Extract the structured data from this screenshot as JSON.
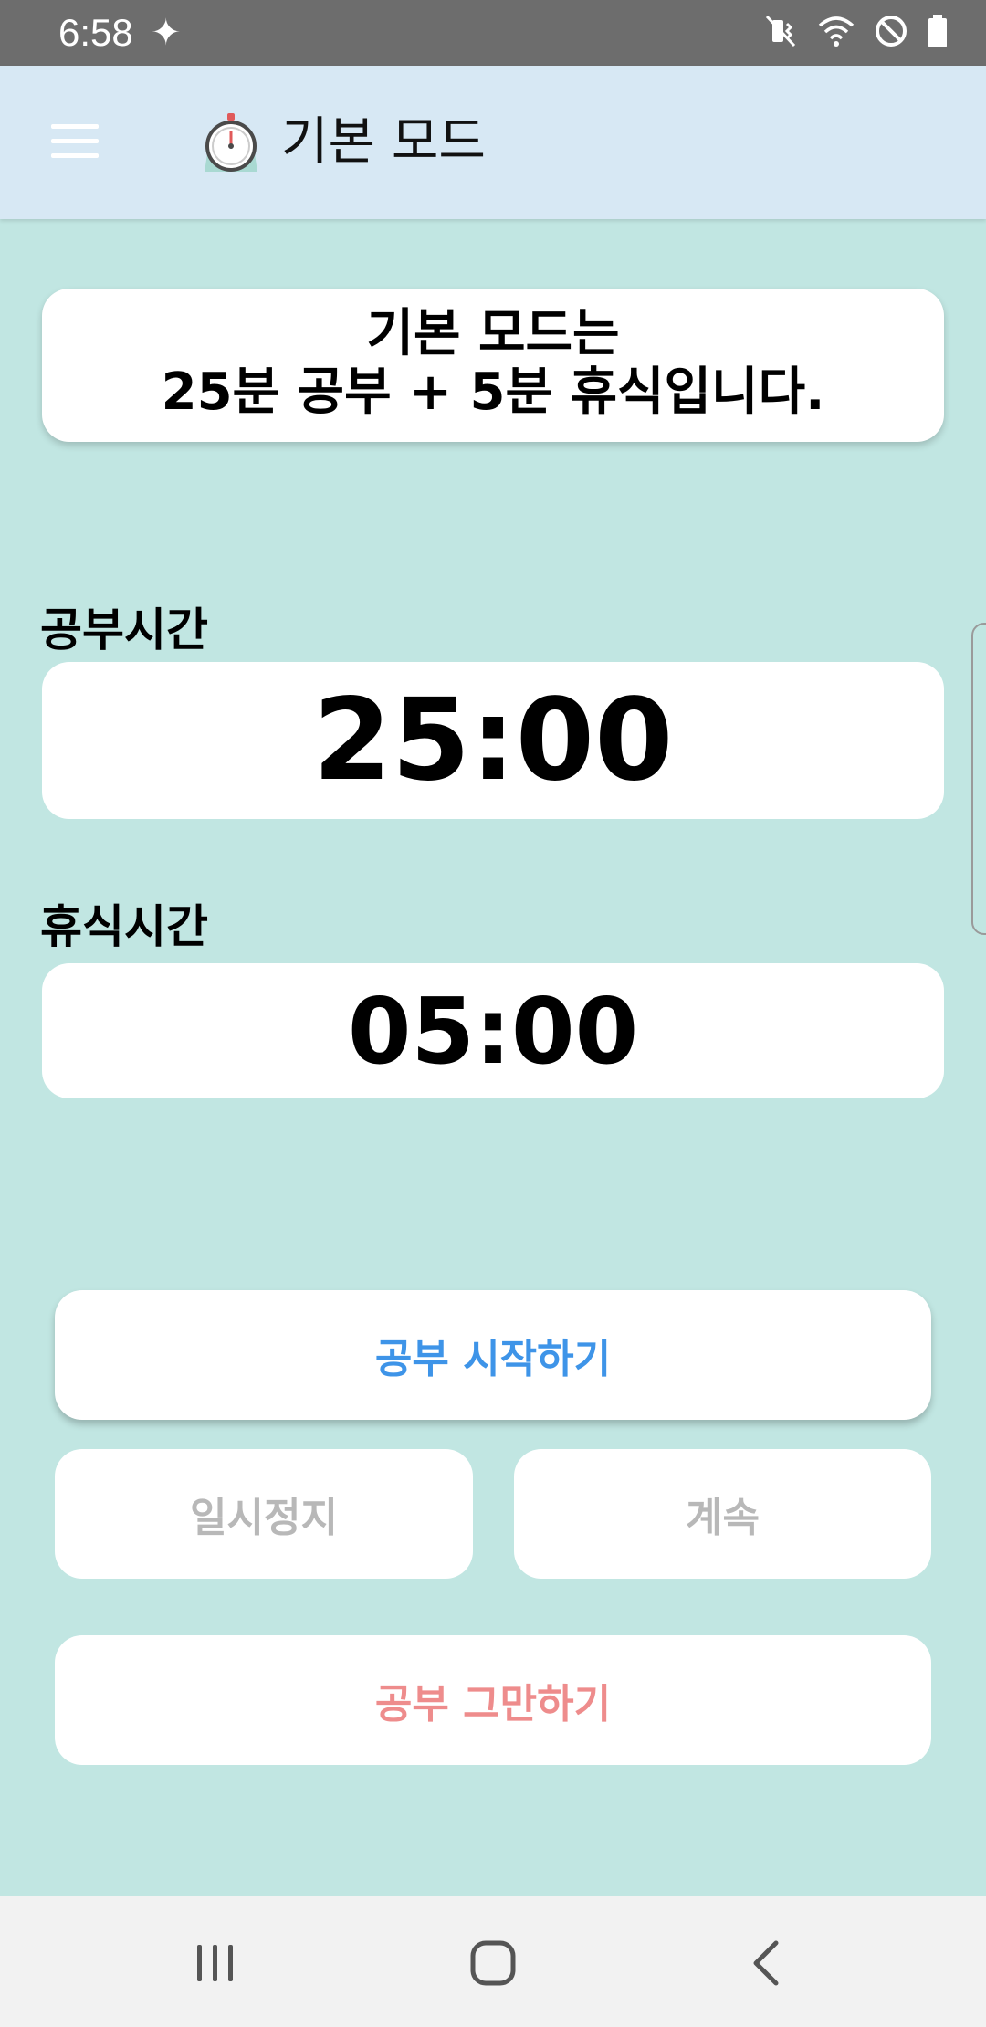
{
  "status_bar": {
    "time": "6:58",
    "sparkle": "✦",
    "icons": [
      "mute-vibrate-icon",
      "wifi-icon",
      "do-not-disturb-icon",
      "battery-icon"
    ]
  },
  "app_bar": {
    "title": "기본 모드",
    "menu_icon": "hamburger-menu-icon",
    "logo_icon": "stopwatch-icon"
  },
  "info": {
    "line1": "기본 모드는",
    "line2": "25분 공부 + 5분 휴식입니다."
  },
  "study": {
    "label": "공부시간",
    "time": "25:00"
  },
  "rest": {
    "label": "휴식시간",
    "time": "05:00"
  },
  "buttons": {
    "start": "공부 시작하기",
    "pause": "일시정지",
    "resume": "계속",
    "stop": "공부 그만하기"
  },
  "nav_bar": {
    "icons": [
      "recent-apps-icon",
      "home-icon",
      "back-icon"
    ]
  },
  "colors": {
    "background": "#c1e6e2",
    "app_bar": "#d7e8f4",
    "start_text": "#3e94e8",
    "disabled_text": "#b8b8b8",
    "stop_text": "#ee8c8c"
  }
}
